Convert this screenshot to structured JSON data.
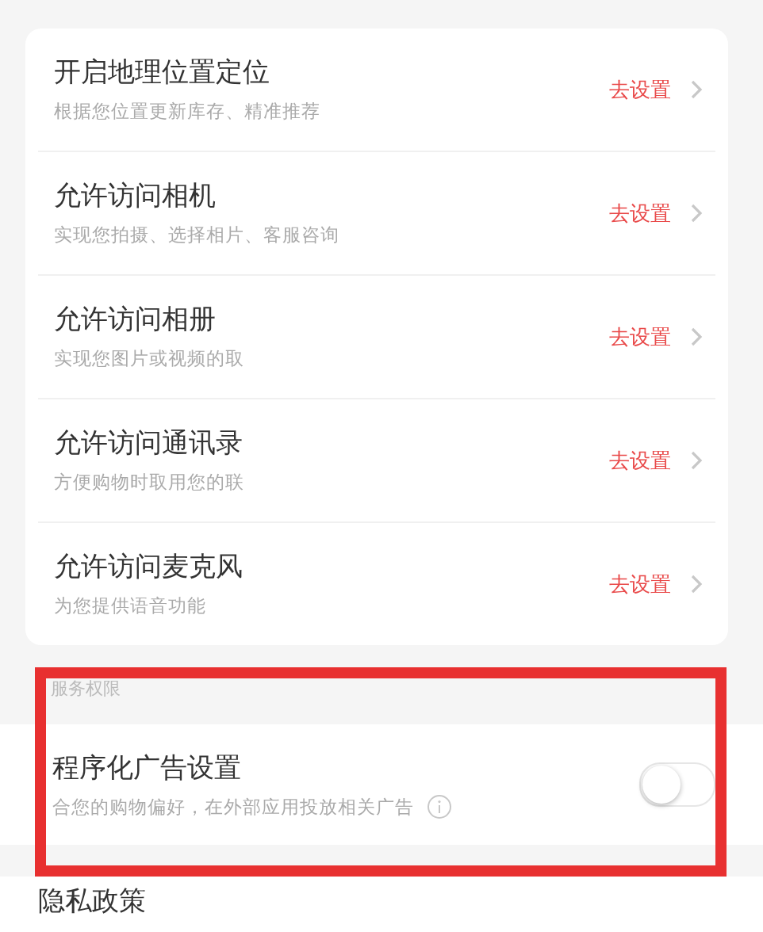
{
  "permissions": [
    {
      "title": "开启地理位置定位",
      "subtitle": "根据您位置更新库存、精准推荐",
      "action": "去设置"
    },
    {
      "title": "允许访问相机",
      "subtitle": "实现您拍摄、选择相片、客服咨询",
      "action": "去设置"
    },
    {
      "title": "允许访问相册",
      "subtitle": "实现您图片或视频的取",
      "action": "去设置"
    },
    {
      "title": "允许访问通讯录",
      "subtitle": "方便购物时取用您的联",
      "action": "去设置"
    },
    {
      "title": "允许访问麦克风",
      "subtitle": "为您提供语音功能",
      "action": "去设置"
    }
  ],
  "service": {
    "label": "服务权限",
    "items": [
      {
        "title": "程序化广告设置",
        "subtitle": "合您的购物偏好，在外部应用投放相关广告",
        "on": false
      }
    ]
  },
  "privacy": {
    "title": "隐私政策"
  }
}
